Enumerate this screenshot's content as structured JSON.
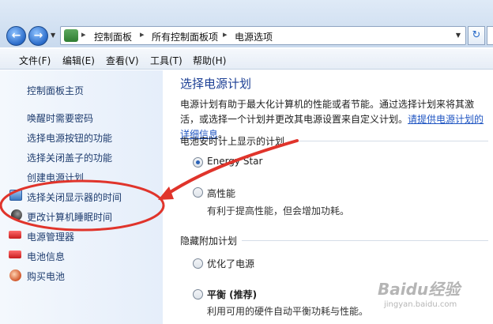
{
  "address": {
    "back": "←",
    "forward": "→",
    "separator": "▸",
    "crumbs": [
      "控制面板",
      "所有控制面板项",
      "电源选项"
    ],
    "dropdown": "▼",
    "refresh": "↻"
  },
  "menu": [
    "文件(F)",
    "编辑(E)",
    "查看(V)",
    "工具(T)",
    "帮助(H)"
  ],
  "sidebar": {
    "home": "控制面板主页",
    "links": [
      "唤醒时需要密码",
      "选择电源按钮的功能",
      "选择关闭盖子的功能",
      "创建电源计划",
      "选择关闭显示器的时间",
      "更改计算机睡眠时间"
    ],
    "tools": [
      "电源管理器",
      "电池信息",
      "购买电池"
    ]
  },
  "main": {
    "title": "选择电源计划",
    "desc_text": "电源计划有助于最大化计算机的性能或者节能。通过选择计划来将其激活，或选择一个计划并更改其电源设置来自定义计划。",
    "desc_link": "请提供电源计划的详细信息",
    "desc_end": "。",
    "group1": "电池安时计上显示的计划",
    "group2": "隐藏附加计划",
    "plans": {
      "energy_star": "Energy Star",
      "high_perf": "高性能",
      "high_perf_desc": "有利于提高性能，但会增加功耗。",
      "optimized": "优化了电源",
      "balanced": "平衡 (推荐)",
      "balanced_desc": "利用可用的硬件自动平衡功耗与性能。"
    },
    "selected_plan": "Energy Star"
  },
  "watermark": {
    "logo": "Baidu经验",
    "site": "jingyan.baidu.com"
  },
  "colors": {
    "link": "#1e3c6e",
    "title": "#1c3f94",
    "annotation": "#e0342b"
  }
}
